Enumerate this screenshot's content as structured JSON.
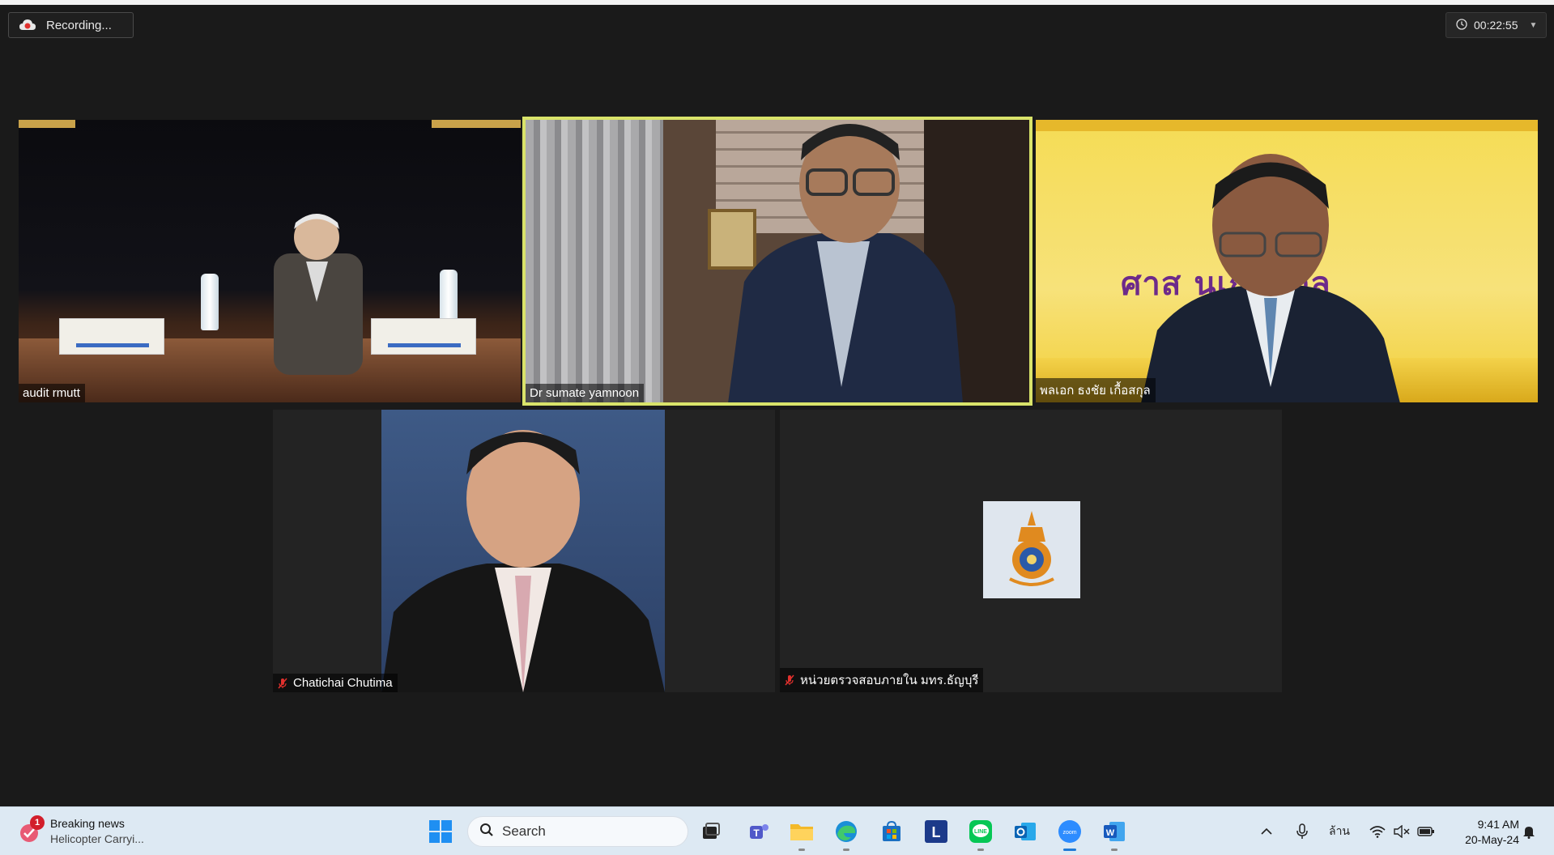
{
  "meeting": {
    "recording_label": "Recording...",
    "timer": "00:22:55"
  },
  "participants": [
    {
      "name": "audit rmutt",
      "muted": false,
      "active": false
    },
    {
      "name": "Dr sumate yamnoon",
      "muted": false,
      "active": true
    },
    {
      "name": "พลเอก ธงชัย เกื้อสกุล",
      "muted": false,
      "active": false,
      "banner_text": "ศาส    นเกื้อสกุล"
    },
    {
      "name": "Chatichai Chutima",
      "muted": true,
      "active": false
    },
    {
      "name": "หน่วยตรวจสอบภายใน มทร.ธัญบุรี",
      "muted": true,
      "active": false
    }
  ],
  "taskbar": {
    "news_badge": "1",
    "news_title": "Breaking news",
    "news_subtitle": "Helicopter Carryi...",
    "search_placeholder": "Search",
    "apps": [
      "windows-start",
      "file-explorer",
      "teams",
      "folder",
      "edge",
      "store",
      "l-app",
      "line",
      "outlook",
      "zoom",
      "word"
    ],
    "language": "ล้าน",
    "time": "9:41 AM",
    "date": "20-May-24"
  },
  "colors": {
    "active_speaker_border": "#d9e36a",
    "background": "#1a1a1a",
    "taskbar": "#dde9f3"
  }
}
